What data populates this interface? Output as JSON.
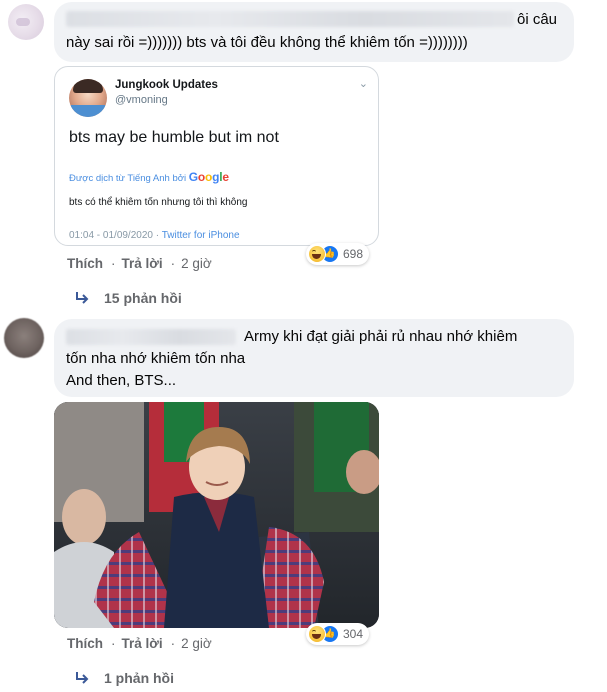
{
  "comment1": {
    "text_line1": "ôi câu",
    "text_line2": "này sai rồi =))))))) bts và tôi đều không thể khiêm tốn =))))))))",
    "embed": {
      "name": "Jungkook Updates",
      "handle": "@vmoning",
      "chevron": "⌄",
      "tweet": "bts may be humble but im not",
      "translated_label": "Được dịch từ Tiếng Anh bởi",
      "google": [
        "G",
        "o",
        "o",
        "g",
        "l",
        "e"
      ],
      "google_colors": [
        "#4285f4",
        "#ea4335",
        "#fbbc05",
        "#4285f4",
        "#34a853",
        "#ea4335"
      ],
      "translation": "bts có thể khiêm tốn nhưng tôi thì không",
      "time": "01:04 - 01/09/2020",
      "separator": " · ",
      "source": "Twitter for iPhone"
    },
    "reaction_count": "698",
    "actions": {
      "like": "Thích",
      "reply": "Trả lời",
      "time": "2 giờ",
      "dot": "·"
    },
    "replies": "15 phản hồi"
  },
  "comment2": {
    "text_line1": "Army khi đạt giải phải rủ nhau nhớ khiêm",
    "text_line2": "tốn nha nhớ khiêm tốn nha",
    "text_line3": "And then, BTS...",
    "reaction_count": "304",
    "actions": {
      "like": "Thích",
      "reply": "Trả lời",
      "time": "2 giờ",
      "dot": "·"
    },
    "replies": "1 phản hồi"
  },
  "icons": {
    "haha": "haha-reaction-icon",
    "like": "like-reaction-icon",
    "reply": "reply-arrow-icon"
  },
  "colors": {
    "bubble": "#f0f2f5",
    "secondary_text": "#65676b",
    "like_blue": "#1877f2",
    "twitter_blue": "#4a8ee0"
  }
}
